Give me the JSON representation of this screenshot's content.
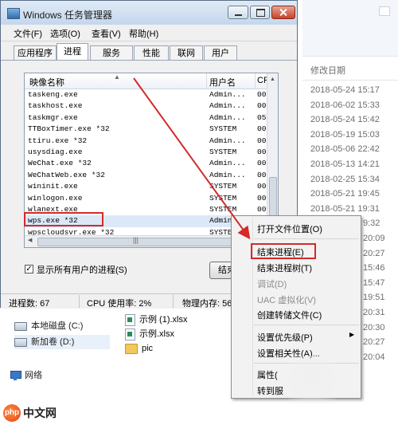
{
  "task_manager": {
    "title": "Windows 任务管理器",
    "menu": [
      "文件(F)",
      "选项(O)",
      "查看(V)",
      "帮助(H)"
    ],
    "tabs": [
      "应用程序",
      "进程",
      "服务",
      "性能",
      "联网",
      "用户"
    ],
    "active_tab": "进程",
    "columns": {
      "name": "映像名称",
      "user": "用户名",
      "cpu": "CP"
    },
    "processes": [
      {
        "name": "taskeng.exe",
        "user": "Admin...",
        "cpu": "00"
      },
      {
        "name": "taskhost.exe",
        "user": "Admin...",
        "cpu": "00"
      },
      {
        "name": "taskmgr.exe",
        "user": "Admin...",
        "cpu": "05"
      },
      {
        "name": "TTBoxTimer.exe *32",
        "user": "SYSTEM",
        "cpu": "00"
      },
      {
        "name": "ttiru.exe *32",
        "user": "Admin...",
        "cpu": "00"
      },
      {
        "name": "usysdiag.exe",
        "user": "SYSTEM",
        "cpu": "00"
      },
      {
        "name": "WeChat.exe *32",
        "user": "Admin...",
        "cpu": "00"
      },
      {
        "name": "WeChatWeb.exe *32",
        "user": "Admin...",
        "cpu": "00"
      },
      {
        "name": "wininit.exe",
        "user": "SYSTEM",
        "cpu": "00"
      },
      {
        "name": "winlogon.exe",
        "user": "SYSTEM",
        "cpu": "00"
      },
      {
        "name": "wlanext.exe",
        "user": "SYSTEM",
        "cpu": "00"
      },
      {
        "name": "wps.exe *32",
        "user": "Admin...",
        "cpu": "00"
      },
      {
        "name": "wpscloudsvr.exe *32",
        "user": "SYSTEM",
        "cpu": "00"
      }
    ],
    "show_all_users": "显示所有用户的进程(S)",
    "end_process_button": "结束",
    "status": {
      "processes": "进程数: 67",
      "cpu": "CPU 使用率: 2%",
      "memory": "物理内存: 56"
    }
  },
  "context_menu": {
    "items": [
      {
        "label": "打开文件位置(O)",
        "disabled": false
      },
      {
        "label": "结束进程(E)",
        "disabled": false
      },
      {
        "label": "结束进程树(T)",
        "disabled": false
      },
      {
        "label": "调试(D)",
        "disabled": true
      },
      {
        "label": "UAC 虚拟化(V)",
        "disabled": true
      },
      {
        "label": "创建转储文件(C)",
        "disabled": false
      },
      {
        "label": "设置优先级(P)",
        "disabled": false
      },
      {
        "label": "设置相关性(A)...",
        "disabled": false
      },
      {
        "label": "属性(",
        "disabled": false
      },
      {
        "label": "转到服",
        "disabled": false
      }
    ]
  },
  "explorer": {
    "column_header": "修改日期",
    "dates": [
      "2018-05-24 15:17",
      "2018-06-02 15:33",
      "2018-05-24 15:42",
      "2018-05-19 15:03",
      "2018-05-06 22:42",
      "2018-05-13 14:21",
      "2018-02-25 15:34",
      "2018-05-21 19:45",
      "2018-05-21 19:31",
      "9:32",
      "20:09",
      "20:27",
      "15:46",
      "15:47",
      "19:51",
      "20:31",
      "20:30",
      "20:27",
      "20:04"
    ],
    "nav": [
      "本地磁盘 (C:)",
      "新加卷 (D:)",
      "网络"
    ],
    "files": [
      "示例 (1).xlsx",
      "示例.xlsx",
      "pic"
    ]
  },
  "watermark": {
    "logo": "php",
    "text": "中文网"
  }
}
